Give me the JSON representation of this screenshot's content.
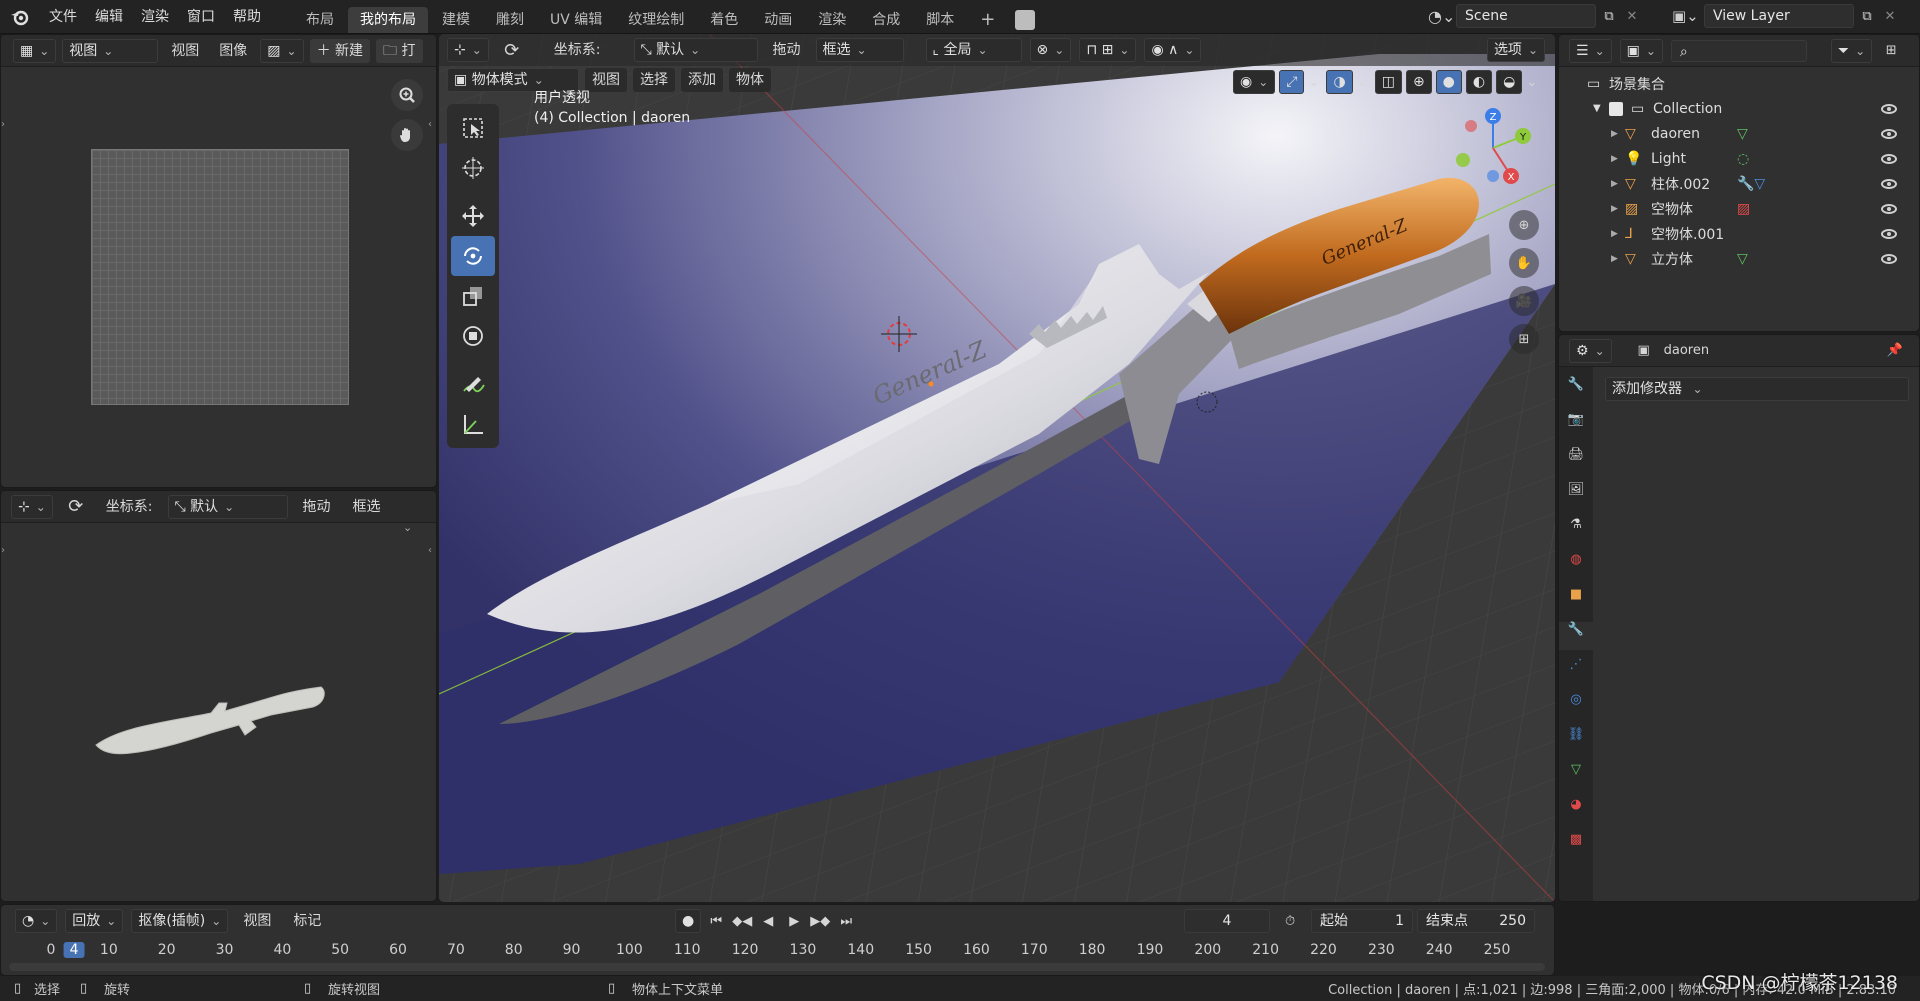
{
  "menu": [
    "文件",
    "编辑",
    "渲染",
    "窗口",
    "帮助"
  ],
  "workspaces": [
    "布局",
    "我的布局",
    "建模",
    "雕刻",
    "UV 编辑",
    "纹理绘制",
    "着色",
    "动画",
    "渲染",
    "合成",
    "脚本"
  ],
  "active_workspace": "我的布局",
  "scene": "Scene",
  "view_layer": "View Layer",
  "image_editor": {
    "view_mode": "视图",
    "menus": [
      "视图",
      "图像"
    ],
    "new": "新建",
    "open": "打"
  },
  "preview_header": {
    "coord_label": "坐标系:",
    "coord_value": "默认",
    "drag": "拖动",
    "select": "框选"
  },
  "viewport_header": {
    "coord_label": "坐标系:",
    "coord_value": "默认",
    "drag": "拖动",
    "select_box": "框选",
    "transform": "全局",
    "options": "选项",
    "mode": "物体模式",
    "menus": [
      "视图",
      "选择",
      "添加",
      "物体"
    ]
  },
  "viewport_overlay": {
    "view_name": "用户透视",
    "context": "(4) Collection | daoren"
  },
  "knife": {
    "blade_text": "General-Z",
    "handle_text": "General-Z"
  },
  "outliner": {
    "root": "场景集合",
    "collection": "Collection",
    "items": [
      {
        "name": "daoren",
        "icon": "mesh-icon",
        "extra": "mesh-data-icon"
      },
      {
        "name": "Light",
        "icon": "light-icon",
        "extra": "light-data-icon"
      },
      {
        "name": "柱体.002",
        "icon": "mesh-icon",
        "extra": "modifier-mesh-icon"
      },
      {
        "name": "空物体",
        "icon": "image-empty-icon",
        "extra": "image-icon"
      },
      {
        "name": "空物体.001",
        "icon": "empty-axes-icon",
        "extra": ""
      },
      {
        "name": "立方体",
        "icon": "mesh-icon",
        "extra": "mesh-data-icon"
      }
    ]
  },
  "properties": {
    "object": "daoren",
    "add_modifier": "添加修改器"
  },
  "timeline": {
    "playback": "回放",
    "keying": "抠像(插帧)",
    "view": "视图",
    "markers": "标记",
    "current_frame": "4",
    "start_label": "起始",
    "start": "1",
    "end_label": "结束点",
    "end": "250",
    "ticks": [
      "0",
      "4",
      "10",
      "20",
      "30",
      "40",
      "50",
      "60",
      "70",
      "80",
      "90",
      "100",
      "110",
      "120",
      "130",
      "140",
      "150",
      "160",
      "170",
      "180",
      "190",
      "200",
      "210",
      "220",
      "230",
      "240",
      "250"
    ]
  },
  "statusbar": {
    "select": "选择",
    "rotate": "旋转",
    "rotate_view": "旋转视图",
    "context_menu": "物体上下文菜单",
    "stats": "Collection | daoren | 点:1,021 | 边:998 | 三角面:2,000 | 物体:0/6 | 内存: 42.0 MiB | 2.83.10",
    "watermark": "CSDN @柠檬茶12138"
  },
  "colors": {
    "accent": "#4772b3",
    "x_axis": "#e14a4a",
    "y_axis": "#8fca3a",
    "z_axis": "#3b7ee8",
    "mesh_orange": "#e9a14a"
  }
}
